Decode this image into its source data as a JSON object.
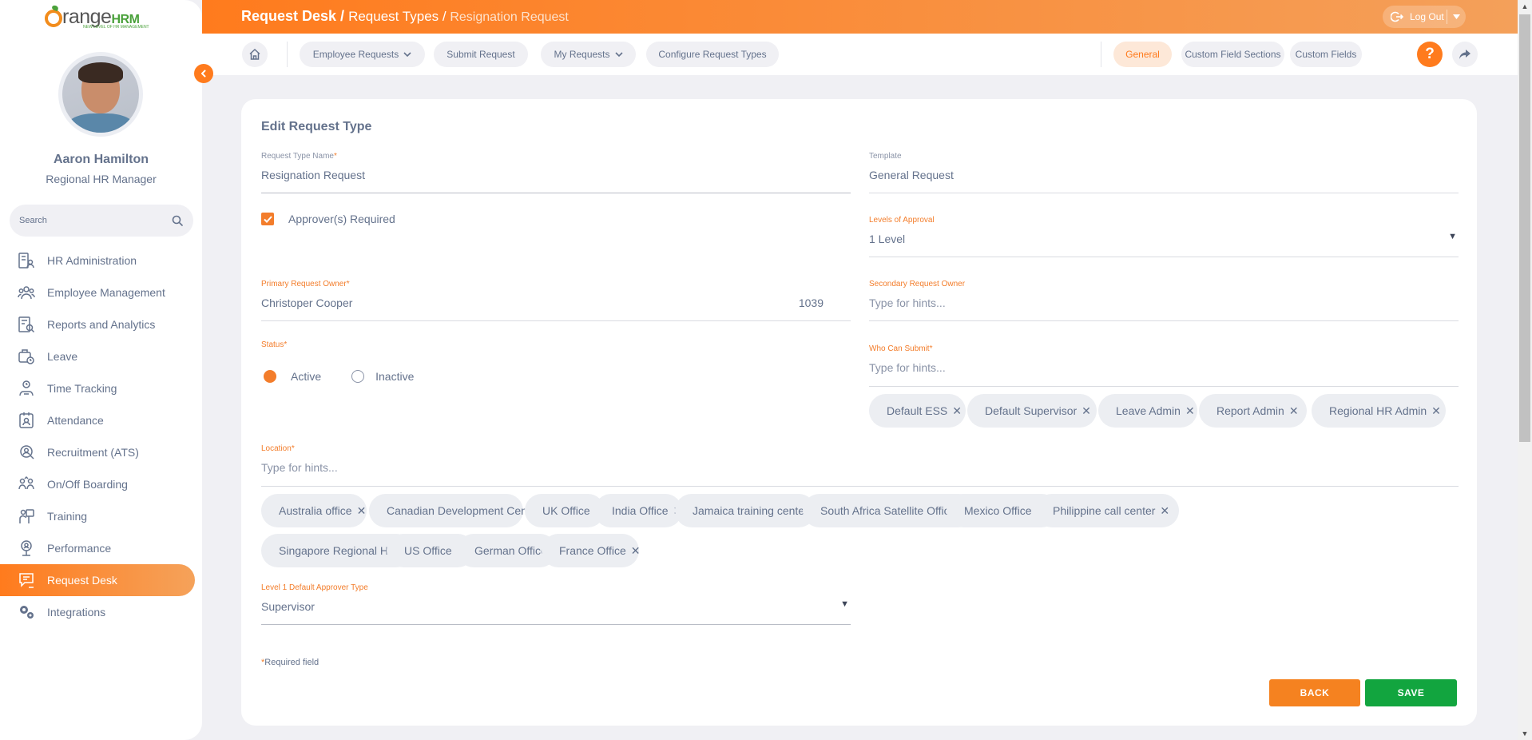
{
  "app": {
    "logo_main": "range",
    "logo_brand": "HRM",
    "logo_tagline": "NEW LEVEL OF HR MANAGEMENT"
  },
  "user": {
    "name": "Aaron Hamilton",
    "role": "Regional HR Manager"
  },
  "search": {
    "placeholder": "Search"
  },
  "sidebar": {
    "items": [
      {
        "label": "HR Administration",
        "icon": "hr-admin-icon"
      },
      {
        "label": "Employee Management",
        "icon": "employees-icon"
      },
      {
        "label": "Reports and Analytics",
        "icon": "reports-icon"
      },
      {
        "label": "Leave",
        "icon": "leave-icon"
      },
      {
        "label": "Time Tracking",
        "icon": "time-icon"
      },
      {
        "label": "Attendance",
        "icon": "attendance-icon"
      },
      {
        "label": "Recruitment (ATS)",
        "icon": "recruitment-icon"
      },
      {
        "label": "On/Off Boarding",
        "icon": "onboarding-icon"
      },
      {
        "label": "Training",
        "icon": "training-icon"
      },
      {
        "label": "Performance",
        "icon": "performance-icon"
      },
      {
        "label": "Request Desk",
        "icon": "request-desk-icon",
        "active": true
      },
      {
        "label": "Integrations",
        "icon": "integrations-icon"
      }
    ]
  },
  "header": {
    "crumb_main": "Request Desk / ",
    "crumb_sub": "Request Types / ",
    "crumb_current": "Resignation Request",
    "logout_label": "Log Out"
  },
  "topnav": {
    "employee_requests": "Employee Requests",
    "submit_request": "Submit Request",
    "my_requests": "My Requests",
    "configure_request_types": "Configure Request Types",
    "general": "General",
    "custom_field_sections": "Custom Field Sections",
    "custom_fields": "Custom Fields",
    "help": "?"
  },
  "form": {
    "title": "Edit Request Type",
    "request_type_name": {
      "label": "Request Type Name",
      "value": "Resignation Request"
    },
    "template": {
      "label": "Template",
      "value": "General Request"
    },
    "approvers_required": {
      "label": "Approver(s) Required",
      "checked": true
    },
    "levels_of_approval": {
      "label": "Levels of Approval",
      "value": "1 Level"
    },
    "primary_request_owner": {
      "label": "Primary Request Owner",
      "value": "Christoper Cooper",
      "id": "1039"
    },
    "secondary_request_owner": {
      "label": "Secondary Request Owner",
      "placeholder": "Type for hints..."
    },
    "status": {
      "label": "Status",
      "active": "Active",
      "inactive": "Inactive",
      "selected": "Active"
    },
    "who_can_submit": {
      "label": "Who Can Submit",
      "placeholder": "Type for hints...",
      "chips": [
        "Default ESS",
        "Default Supervisor",
        "Leave Admin",
        "Report Admin",
        "Regional HR Admin"
      ]
    },
    "location": {
      "label": "Location",
      "placeholder": "Type for hints...",
      "chips": [
        "Australia office",
        "Canadian Development Center",
        "UK Office",
        "India Office",
        "Jamaica training center",
        "South Africa Satellite Office",
        "Mexico Office",
        "Philippine call center",
        "Singapore Regional HQ",
        "US Office",
        "German Office",
        "France Office"
      ]
    },
    "level1_default_approver": {
      "label": "Level 1 Default Approver Type",
      "value": "Supervisor"
    },
    "required_note": "Required field",
    "required_mark": "*",
    "back_label": "BACK",
    "save_label": "SAVE"
  },
  "colors": {
    "accent": "#ff7b1d",
    "save": "#12a53f",
    "back": "#f58220",
    "text": "#64728c"
  }
}
